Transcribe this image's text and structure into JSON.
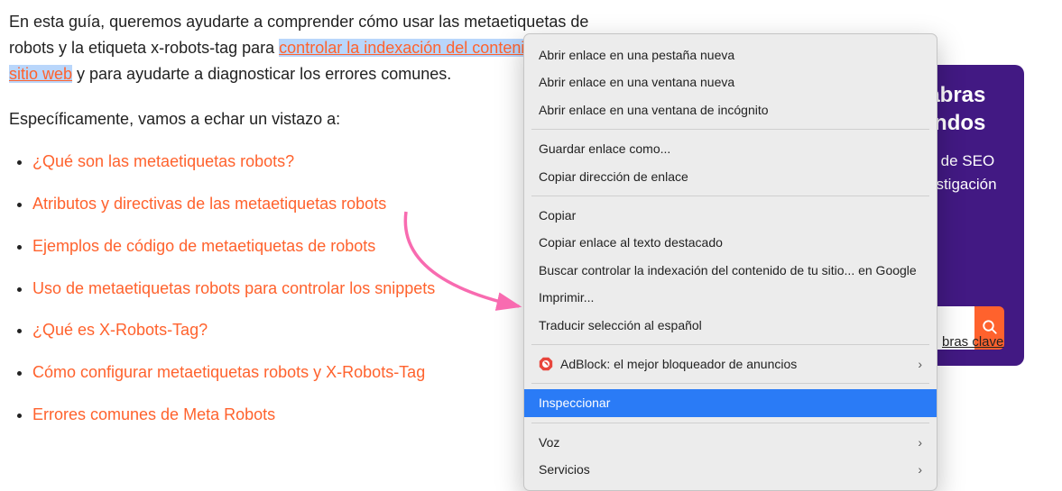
{
  "intro": {
    "prefix": "En esta guía, queremos ayudarte a comprender cómo usar las metaetiquetas de robots y la etiqueta x-robots-tag para ",
    "link_text": "controlar la indexación del contenido de tu sitio web",
    "suffix": " y para ayudarte a diagnosticar los errores comunes."
  },
  "subhead": "Específicamente, vamos a echar un vistazo a:",
  "toc": [
    "¿Qué son las metaetiquetas robots?",
    "Atributos y directivas de las metaetiquetas robots",
    "Ejemplos de código de metaetiquetas de robots",
    "Uso de metaetiquetas robots para controlar los snippets",
    "¿Qué es X-Robots-Tag?",
    "Cómo configurar metaetiquetas robots y X-Robots-Tag",
    "Errores comunes de Meta Robots"
  ],
  "sidebar": {
    "title_line1": "Descubre palabras",
    "title_line2": "clave en segundos",
    "desc": "Impulsa tus resultados de SEO con una poderosa investigación de Keywords",
    "placeholder": "Introduce palabras clave",
    "caption": "bras clave"
  },
  "context_menu": {
    "groups": [
      {
        "items": [
          {
            "label": "Abrir enlace en una pestaña nueva",
            "selected": false,
            "submenu": false
          },
          {
            "label": "Abrir enlace en una ventana nueva",
            "selected": false,
            "submenu": false
          },
          {
            "label": "Abrir enlace en una ventana de incógnito",
            "selected": false,
            "submenu": false
          }
        ]
      },
      {
        "items": [
          {
            "label": "Guardar enlace como...",
            "selected": false,
            "submenu": false
          },
          {
            "label": "Copiar dirección de enlace",
            "selected": false,
            "submenu": false
          }
        ]
      },
      {
        "items": [
          {
            "label": "Copiar",
            "selected": false,
            "submenu": false
          },
          {
            "label": "Copiar enlace al texto destacado",
            "selected": false,
            "submenu": false
          },
          {
            "label": "Buscar controlar la indexación del contenido de tu sitio... en Google",
            "selected": false,
            "submenu": false
          },
          {
            "label": "Imprimir...",
            "selected": false,
            "submenu": false
          },
          {
            "label": "Traducir selección al español",
            "selected": false,
            "submenu": false
          }
        ]
      },
      {
        "items": [
          {
            "label": "AdBlock: el mejor bloqueador de anuncios",
            "selected": false,
            "submenu": true,
            "icon": "adblock"
          }
        ]
      },
      {
        "items": [
          {
            "label": "Inspeccionar",
            "selected": true,
            "submenu": false
          }
        ]
      },
      {
        "items": [
          {
            "label": "Voz",
            "selected": false,
            "submenu": true
          },
          {
            "label": "Servicios",
            "selected": false,
            "submenu": true
          }
        ]
      }
    ]
  }
}
